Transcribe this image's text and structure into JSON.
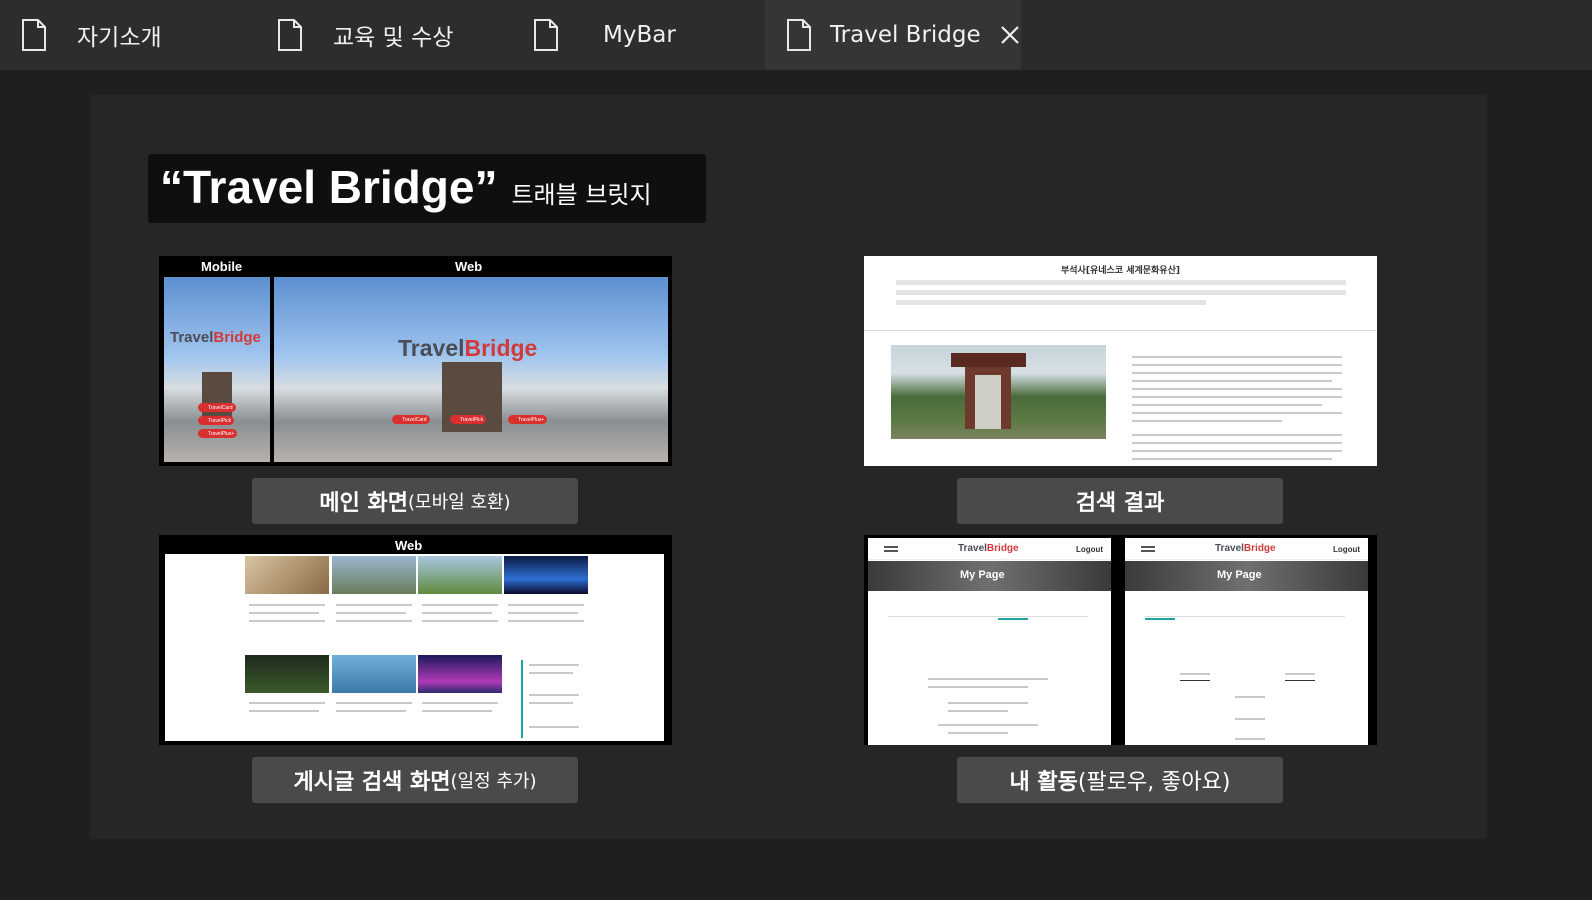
{
  "tabs": [
    {
      "label": "자기소개",
      "active": false
    },
    {
      "label": "교육 및 수상",
      "active": false
    },
    {
      "label": "MyBar",
      "active": false
    },
    {
      "label": "Travel Bridge",
      "active": true
    }
  ],
  "header": {
    "title": "“Travel Bridge”",
    "subtitle": "트래블 브릿지"
  },
  "cards": {
    "main": {
      "caption_bold": "메인 화면",
      "caption_small": "(모바일 호환)",
      "label_mobile": "Mobile",
      "label_web": "Web",
      "logo_travel": "Travel",
      "logo_bridge": "Bridge"
    },
    "search": {
      "caption_bold": "검색 결과",
      "caption_small": "",
      "page_heading": "부석사[유네스코 세계문화유산]"
    },
    "board": {
      "caption_bold": "게시글 검색 화면",
      "caption_small": "(일정 추가)",
      "label_web": "Web"
    },
    "activity": {
      "caption_bold": "내 활동",
      "caption_small": "(팔로우, 좋아요)",
      "app_name_travel": "Travel",
      "app_name_bridge": "Bridge",
      "logout": "Logout",
      "my_page": "My Page"
    }
  },
  "colors": {
    "background": "#1f1f1f",
    "panel": "#262626",
    "tabbar": "#2b2b2b",
    "caption": "#4a4a4a",
    "brand_red": "#d23a3a"
  }
}
